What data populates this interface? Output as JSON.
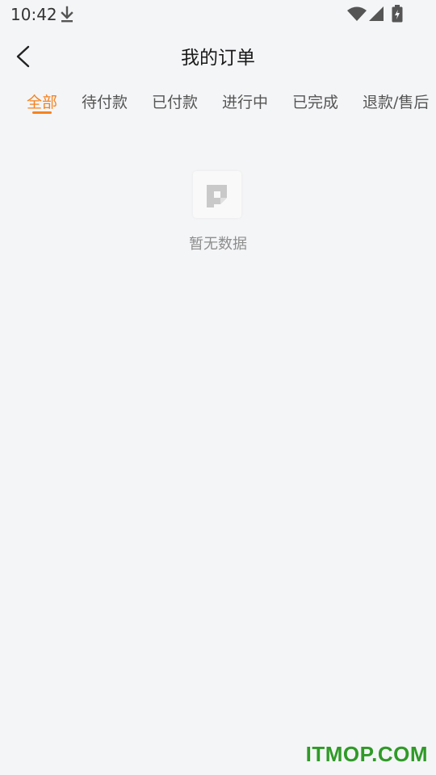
{
  "status_bar": {
    "time": "10:42",
    "icons": [
      "download-icon",
      "wifi-icon",
      "signal-icon",
      "battery-icon"
    ]
  },
  "header": {
    "title": "我的订单",
    "back_icon": "chevron-left-icon"
  },
  "tabs": {
    "items": [
      {
        "label": "全部"
      },
      {
        "label": "待付款"
      },
      {
        "label": "已付款"
      },
      {
        "label": "进行中"
      },
      {
        "label": "已完成"
      },
      {
        "label": "退款/售后"
      }
    ],
    "active_index": 0,
    "active_color": "#f5821f",
    "inactive_color": "#555555"
  },
  "empty_state": {
    "icon": "empty-document-icon",
    "text": "暂无数据"
  },
  "watermark": {
    "text": "ITMOP.COM",
    "color": "#2f9a27"
  },
  "colors": {
    "background": "#f4f5f7",
    "accent": "#f5821f"
  }
}
